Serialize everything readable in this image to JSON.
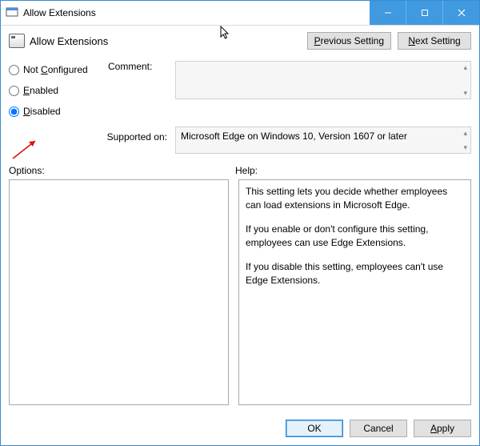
{
  "window": {
    "title": "Allow Extensions"
  },
  "header": {
    "page_title": "Allow Extensions",
    "prev_button_label": "Previous Setting",
    "next_button_label": "Next Setting"
  },
  "state": {
    "options": {
      "not_configured": "Not Configured",
      "enabled": "Enabled",
      "disabled": "Disabled",
      "selected": "disabled"
    },
    "comment_label": "Comment:",
    "comment_value": "",
    "supported_label": "Supported on:",
    "supported_value": "Microsoft Edge on Windows 10, Version 1607 or later"
  },
  "sections": {
    "options_label": "Options:",
    "help_label": "Help:"
  },
  "help": {
    "p1": "This setting lets you decide whether employees can load extensions in Microsoft Edge.",
    "p2": "If you enable or don't configure this setting, employees can use Edge Extensions.",
    "p3": "If you disable this setting, employees can't use Edge Extensions."
  },
  "footer": {
    "ok": "OK",
    "cancel": "Cancel",
    "apply": "Apply"
  }
}
